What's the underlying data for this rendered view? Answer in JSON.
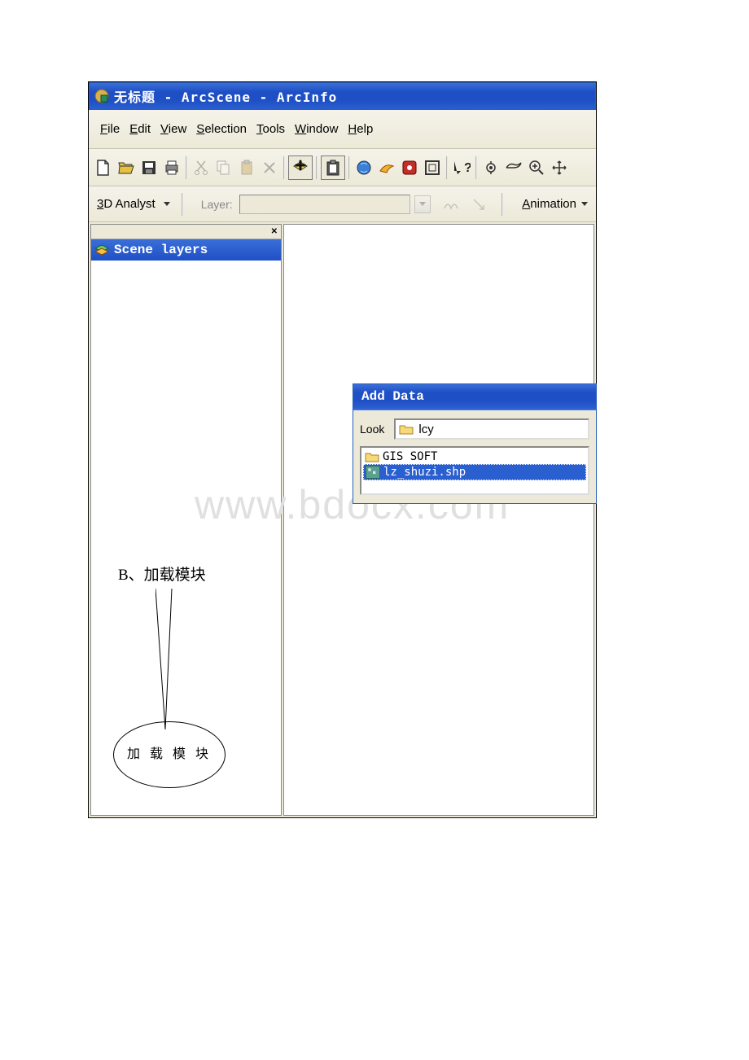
{
  "window": {
    "title": "无标题 - ArcScene - ArcInfo"
  },
  "menubar": {
    "file": "File",
    "edit": "Edit",
    "view": "View",
    "selection": "Selection",
    "tools": "Tools",
    "window": "Window",
    "help": "Help"
  },
  "toolbar2": {
    "analyst": "3D Analyst",
    "layer_label": "Layer:",
    "animation": "Animation"
  },
  "sidebar": {
    "scene_layers": "Scene layers"
  },
  "add_data": {
    "title": "Add Data",
    "look_label": "Look",
    "look_value": "lcy",
    "files": [
      {
        "name": "GIS SOFT",
        "type": "folder",
        "selected": false
      },
      {
        "name": "lz_shuzi.shp",
        "type": "shapefile",
        "selected": true
      }
    ]
  },
  "annotation": {
    "label": "B、加载模块",
    "ellipse_text": "加 载 模 块"
  },
  "watermark": "www.bdocx.com"
}
